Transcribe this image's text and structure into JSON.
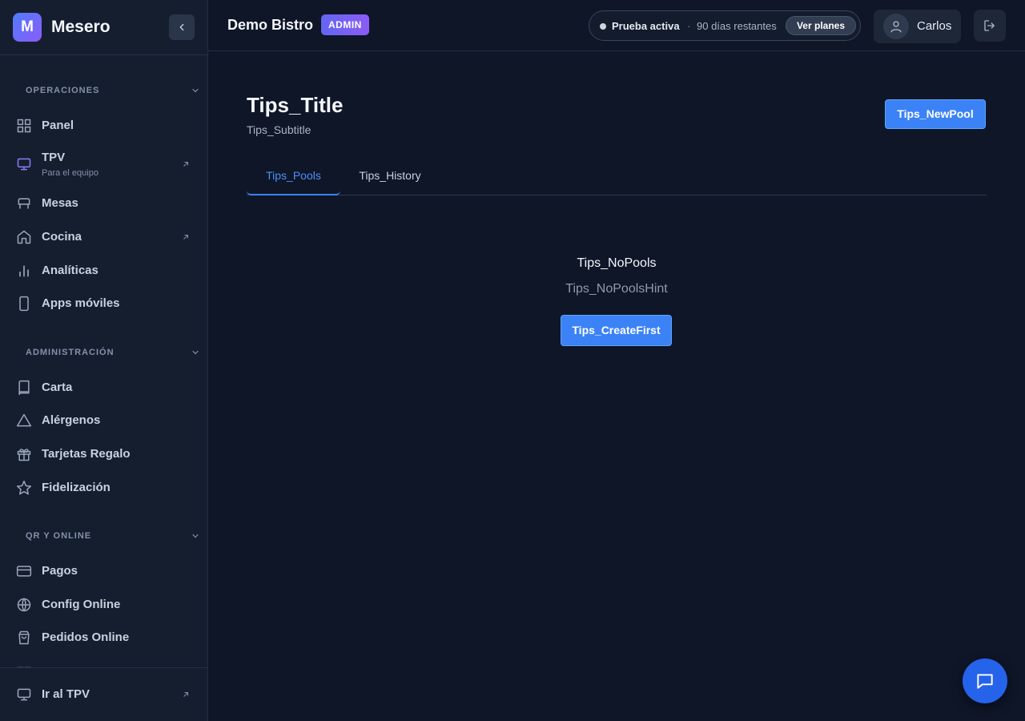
{
  "app": {
    "logo_letter": "M",
    "name": "Mesero"
  },
  "sidebar": {
    "sections": [
      {
        "title": "OPERACIONES",
        "items": [
          {
            "label": "Panel",
            "icon": "grid-icon"
          },
          {
            "label": "TPV",
            "sublabel": "Para el equipo",
            "icon": "monitor-icon",
            "external": true
          },
          {
            "label": "Mesas",
            "icon": "table-icon"
          },
          {
            "label": "Cocina",
            "icon": "home-icon",
            "external": true
          },
          {
            "label": "Analíticas",
            "icon": "bar-chart-icon"
          },
          {
            "label": "Apps móviles",
            "icon": "smartphone-icon"
          }
        ]
      },
      {
        "title": "ADMINISTRACIÓN",
        "items": [
          {
            "label": "Carta",
            "icon": "book-icon"
          },
          {
            "label": "Alérgenos",
            "icon": "alert-triangle-icon"
          },
          {
            "label": "Tarjetas Regalo",
            "icon": "gift-icon"
          },
          {
            "label": "Fidelización",
            "icon": "star-icon"
          }
        ]
      },
      {
        "title": "QR Y ONLINE",
        "items": [
          {
            "label": "Pagos",
            "icon": "credit-card-icon"
          },
          {
            "label": "Config Online",
            "icon": "globe-icon"
          },
          {
            "label": "Pedidos Online",
            "icon": "shopping-bag-icon"
          }
        ]
      }
    ],
    "footer": {
      "label": "Ir al TPV",
      "icon": "monitor-icon"
    }
  },
  "header": {
    "org_name": "Demo Bistro",
    "role_badge": "ADMIN",
    "trial": {
      "status": "Prueba activa",
      "separator": "·",
      "days_left": "90 días restantes",
      "plans_button": "Ver planes"
    },
    "user_name": "Carlos"
  },
  "main": {
    "title": "Tips_Title",
    "subtitle": "Tips_Subtitle",
    "new_pool_button": "Tips_NewPool",
    "tabs": [
      {
        "label": "Tips_Pools",
        "active": true
      },
      {
        "label": "Tips_History",
        "active": false
      }
    ],
    "empty_state": {
      "title": "Tips_NoPools",
      "hint": "Tips_NoPoolsHint",
      "button": "Tips_CreateFirst"
    }
  },
  "colors": {
    "accent": "#3b82f6",
    "background": "#0e1628",
    "sidebar": "#151e2f"
  }
}
